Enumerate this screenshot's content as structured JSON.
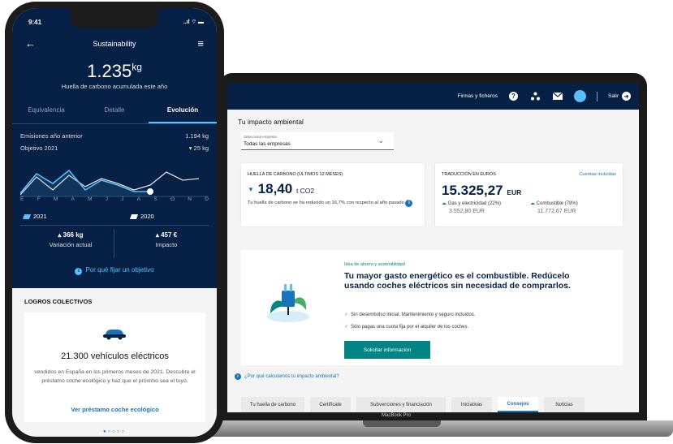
{
  "laptop": {
    "nav": {
      "firmas": "Firmas y ficheros",
      "exit": "Salir"
    },
    "title": "Tu impacto ambiental",
    "company_select": {
      "label": "Selecciona empresa",
      "value": "Todas las empresas"
    },
    "footprint_card": {
      "label": "HUELLA DE CARBONO (ÚLTIMOS 12 MESES)",
      "value": "18,40",
      "unit": "t CO2",
      "desc": "Tu huella de carbono se ha reducido un 16,7% con respecto al año pasado"
    },
    "euro_card": {
      "label": "TRADUCCIÓN EN EUROS",
      "link": "Cuentas incluidas",
      "value": "15.325,27",
      "unit": "EUR",
      "gas_label": "Gas y electricidad (22%)",
      "gas_value": "3.552,80 EUR",
      "fuel_label": "Combustible (78%)",
      "fuel_value": "11.772,67 EUR"
    },
    "tip": {
      "tag": "Idea de ahorro y sostenibilidad",
      "headline": "Tu mayor gasto energético es el combustible. Redúcelo usando coches eléctricos sin necesidad de comprarlos.",
      "check1": "Sin desembolso inicial. Mantenimiento y seguro incluidos.",
      "check2": "Sólo pagas una cuota fija por el alquiler de los coches.",
      "button": "Solicitar información"
    },
    "why_link": "¿Por qué calculamos tu impacto ambiental?",
    "tabs": [
      "Tu huella de carbono",
      "Certifícate",
      "Subvenciones y financiación",
      "Iniciativas",
      "Consejos",
      "Noticias"
    ],
    "active_tab": "Consejos",
    "device_label": "MacBook Pro"
  },
  "phone": {
    "status": {
      "time": "9:41",
      "icons": "..ıl ⌔ ▬"
    },
    "header": {
      "title": "Sustainability"
    },
    "total": {
      "value": "1.235",
      "unit": "kg",
      "label": "Huella de carbono acumulada este año"
    },
    "tabs": [
      "Equivalencia",
      "Detalle",
      "Evolución"
    ],
    "active_tab": "Evolución",
    "prev_year": {
      "label": "Emisiones año anterior",
      "value": "1.194 kg"
    },
    "target": {
      "label": "Objetivo 2021",
      "value": "▾ 25 kg"
    },
    "months": [
      "E",
      "F",
      "M",
      "A",
      "M",
      "J",
      "J",
      "A",
      "S",
      "O",
      "N",
      "D"
    ],
    "legend": {
      "y2021": "2021",
      "y2020": "2020"
    },
    "stats": {
      "variation_value": "▴ 366 kg",
      "variation_label": "Variación actual",
      "impact_value": "▴ 457 €",
      "impact_label": "Impacto"
    },
    "why_target": "Por qué fijar un objetivo",
    "logros_title": "LOGROS COLECTIVOS",
    "logros_card": {
      "title": "21.300 vehículos eléctricos",
      "desc": "vendidos en España en los primeros meses de 2021. Descubre el préstamo coche ecológico y haz que el próximo sea el tuyo.",
      "link": "Ver préstamo coche ecológico"
    },
    "pager": "●○○○○"
  },
  "colors": {
    "navy": "#072146",
    "blue": "#1973b8",
    "light_blue": "#5bbeff",
    "teal": "#028484",
    "green": "#48ae64"
  },
  "icons": [
    "help-icon",
    "org-icon",
    "mail-icon",
    "avatar",
    "exit-icon",
    "back-icon",
    "menu-icon",
    "info-icon",
    "car-icon",
    "plug-leaf-illustration",
    "leaf-icon",
    "check-icon"
  ]
}
